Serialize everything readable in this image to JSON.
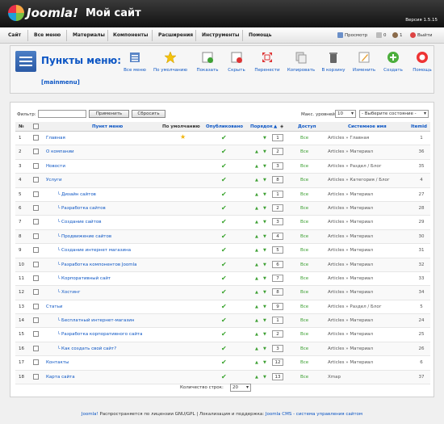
{
  "header": {
    "logo_text": "Joomla!",
    "site_name": "Мой сайт",
    "version": "Версия 1.5.15"
  },
  "menubar": {
    "items": [
      "Сайт",
      "Все меню",
      "Материалы",
      "Компоненты",
      "Расширения",
      "Инструменты",
      "Помощь"
    ],
    "preview": "Просмотр",
    "messages": "0",
    "users": "1",
    "logout": "Выйти"
  },
  "toolbar": {
    "title": "Пункты меню:",
    "menutype": "[mainmenu]",
    "buttons": [
      "Все меню",
      "По умолчанию",
      "Показать",
      "Скрыть",
      "Перенести",
      "Копировать",
      "В корзину",
      "Изменить",
      "Создать",
      "Помощь"
    ]
  },
  "filter": {
    "label": "Фильтр:",
    "value": "",
    "apply": "Применить",
    "reset": "Сбросить",
    "levels_label": "Макс. уровней",
    "levels_value": "10",
    "state_value": "- Выберите состояние -"
  },
  "table": {
    "headers": {
      "num": "№",
      "name": "Пункт меню",
      "default": "По умолчанию",
      "published": "Опубликовано",
      "order": "Порядок",
      "access": "Доступ",
      "type": "Системное имя",
      "itemid": "Itemid"
    },
    "rows": [
      {
        "n": "1",
        "name": "Главная",
        "default": true,
        "order": "1",
        "access": "Все",
        "type": "Articles » Главная",
        "id": "1"
      },
      {
        "n": "2",
        "name": "О компании",
        "default": false,
        "order": "2",
        "access": "Все",
        "type": "Articles » Материал",
        "id": "36"
      },
      {
        "n": "3",
        "name": "Новости",
        "default": false,
        "order": "3",
        "access": "Все",
        "type": "Articles » Раздел / Блог",
        "id": "35"
      },
      {
        "n": "4",
        "name": "Услуги",
        "default": false,
        "order": "8",
        "access": "Все",
        "type": "Articles » Категория / Блог",
        "id": "4"
      },
      {
        "n": "5",
        "name": "└ Дизайн сайтов",
        "default": false,
        "order": "1",
        "access": "Все",
        "type": "Articles » Материал",
        "id": "27"
      },
      {
        "n": "6",
        "name": "└ Разработка сайтов",
        "default": false,
        "order": "2",
        "access": "Все",
        "type": "Articles » Материал",
        "id": "28"
      },
      {
        "n": "7",
        "name": "└ Создание сайтов",
        "default": false,
        "order": "3",
        "access": "Все",
        "type": "Articles » Материал",
        "id": "29"
      },
      {
        "n": "8",
        "name": "└ Продвижение сайтов",
        "default": false,
        "order": "4",
        "access": "Все",
        "type": "Articles » Материал",
        "id": "30"
      },
      {
        "n": "9",
        "name": "└ Создание интернет магазина",
        "default": false,
        "order": "5",
        "access": "Все",
        "type": "Articles » Материал",
        "id": "31"
      },
      {
        "n": "10",
        "name": "└ Разработка компонентов Joomla",
        "default": false,
        "order": "6",
        "access": "Все",
        "type": "Articles » Материал",
        "id": "32"
      },
      {
        "n": "11",
        "name": "└ Корпоративный сайт",
        "default": false,
        "order": "7",
        "access": "Все",
        "type": "Articles » Материал",
        "id": "33"
      },
      {
        "n": "12",
        "name": "└ Хостинг",
        "default": false,
        "order": "8",
        "access": "Все",
        "type": "Articles » Материал",
        "id": "34"
      },
      {
        "n": "13",
        "name": "Статьи",
        "default": false,
        "order": "9",
        "access": "Все",
        "type": "Articles » Раздел / Блог",
        "id": "5"
      },
      {
        "n": "14",
        "name": "└ Бесплатный интернет-магазин",
        "default": false,
        "order": "1",
        "access": "Все",
        "type": "Articles » Материал",
        "id": "24"
      },
      {
        "n": "15",
        "name": "└ Разработка корпоративного сайта",
        "default": false,
        "order": "2",
        "access": "Все",
        "type": "Articles » Материал",
        "id": "25"
      },
      {
        "n": "16",
        "name": "└ Как создать свой сайт?",
        "default": false,
        "order": "3",
        "access": "Все",
        "type": "Articles » Материал",
        "id": "26"
      },
      {
        "n": "17",
        "name": "Контакты",
        "default": false,
        "order": "12",
        "access": "Все",
        "type": "Articles » Материал",
        "id": "6"
      },
      {
        "n": "18",
        "name": "Карта сайта",
        "default": false,
        "order": "13",
        "access": "Все",
        "type": "Xmap",
        "id": "37"
      }
    ]
  },
  "pagination": {
    "label": "Количество строк:",
    "value": "20"
  },
  "footer": {
    "joomla": "Joomla!",
    "text1": " Распространяется по лицензии GNU/GPL | Локализация и поддержка: ",
    "link": "Joomla CMS - система управления сайтом"
  }
}
